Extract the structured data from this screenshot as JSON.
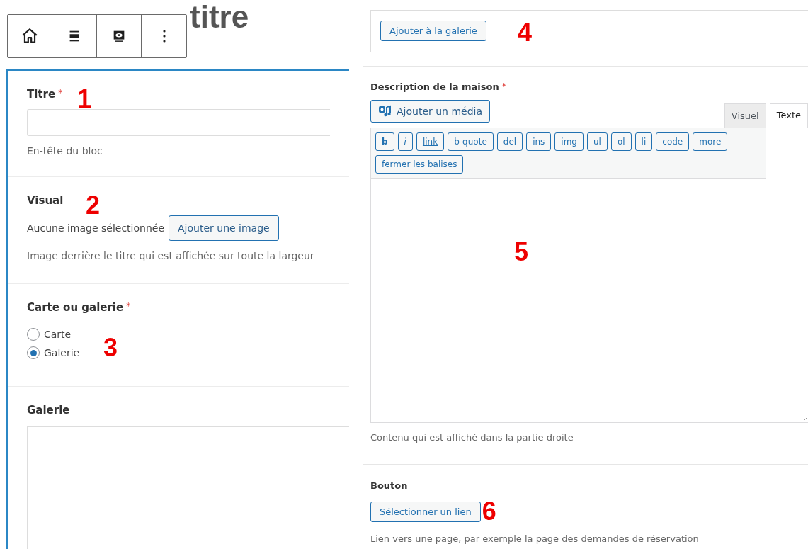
{
  "page_title": "titre",
  "left_fields": [
    {
      "kind": "text",
      "label": "Titre",
      "required_mark": "*",
      "help": "En-tête du bloc",
      "marker": "1"
    },
    {
      "kind": "image",
      "label": "Visual",
      "status": "Aucune image sélectionnée",
      "button": "Ajouter une image",
      "help": "Image derrière le titre qui est affichée sur toute la largeur",
      "marker": "2"
    },
    {
      "kind": "radio",
      "label": "Carte ou galerie",
      "required_mark": "*",
      "options": [
        {
          "label": "Carte",
          "selected": false
        },
        {
          "label": "Galerie",
          "selected": true
        }
      ],
      "marker": "3"
    },
    {
      "kind": "gallery",
      "label": "Galerie"
    }
  ],
  "gallery_box": {
    "button": "Ajouter à la galerie",
    "marker": "4"
  },
  "description": {
    "label": "Description de la maison",
    "required_mark": "*",
    "media_button": "Ajouter un média",
    "tabs": [
      {
        "label": "Visuel",
        "selected": false
      },
      {
        "label": "Texte",
        "selected": true
      }
    ],
    "quicktags": [
      {
        "label": "b",
        "kind": "bold"
      },
      {
        "label": "i",
        "kind": "italic"
      },
      {
        "label": "link",
        "kind": "underline"
      },
      {
        "label": "b-quote",
        "kind": "plain"
      },
      {
        "label": "del",
        "kind": "strike"
      },
      {
        "label": "ins",
        "kind": "plain"
      },
      {
        "label": "img",
        "kind": "plain"
      },
      {
        "label": "ul",
        "kind": "plain"
      },
      {
        "label": "ol",
        "kind": "plain"
      },
      {
        "label": "li",
        "kind": "plain"
      },
      {
        "label": "code",
        "kind": "plain"
      },
      {
        "label": "more",
        "kind": "plain"
      },
      {
        "label": "fermer les balises",
        "kind": "plain"
      }
    ],
    "marker": "5",
    "help": "Contenu qui est affiché dans la partie droite"
  },
  "link_field": {
    "label": "Bouton",
    "button": "Sélectionner un lien",
    "marker": "6",
    "help": "Lien vers une page, par exemple la page des demandes de réservation"
  }
}
